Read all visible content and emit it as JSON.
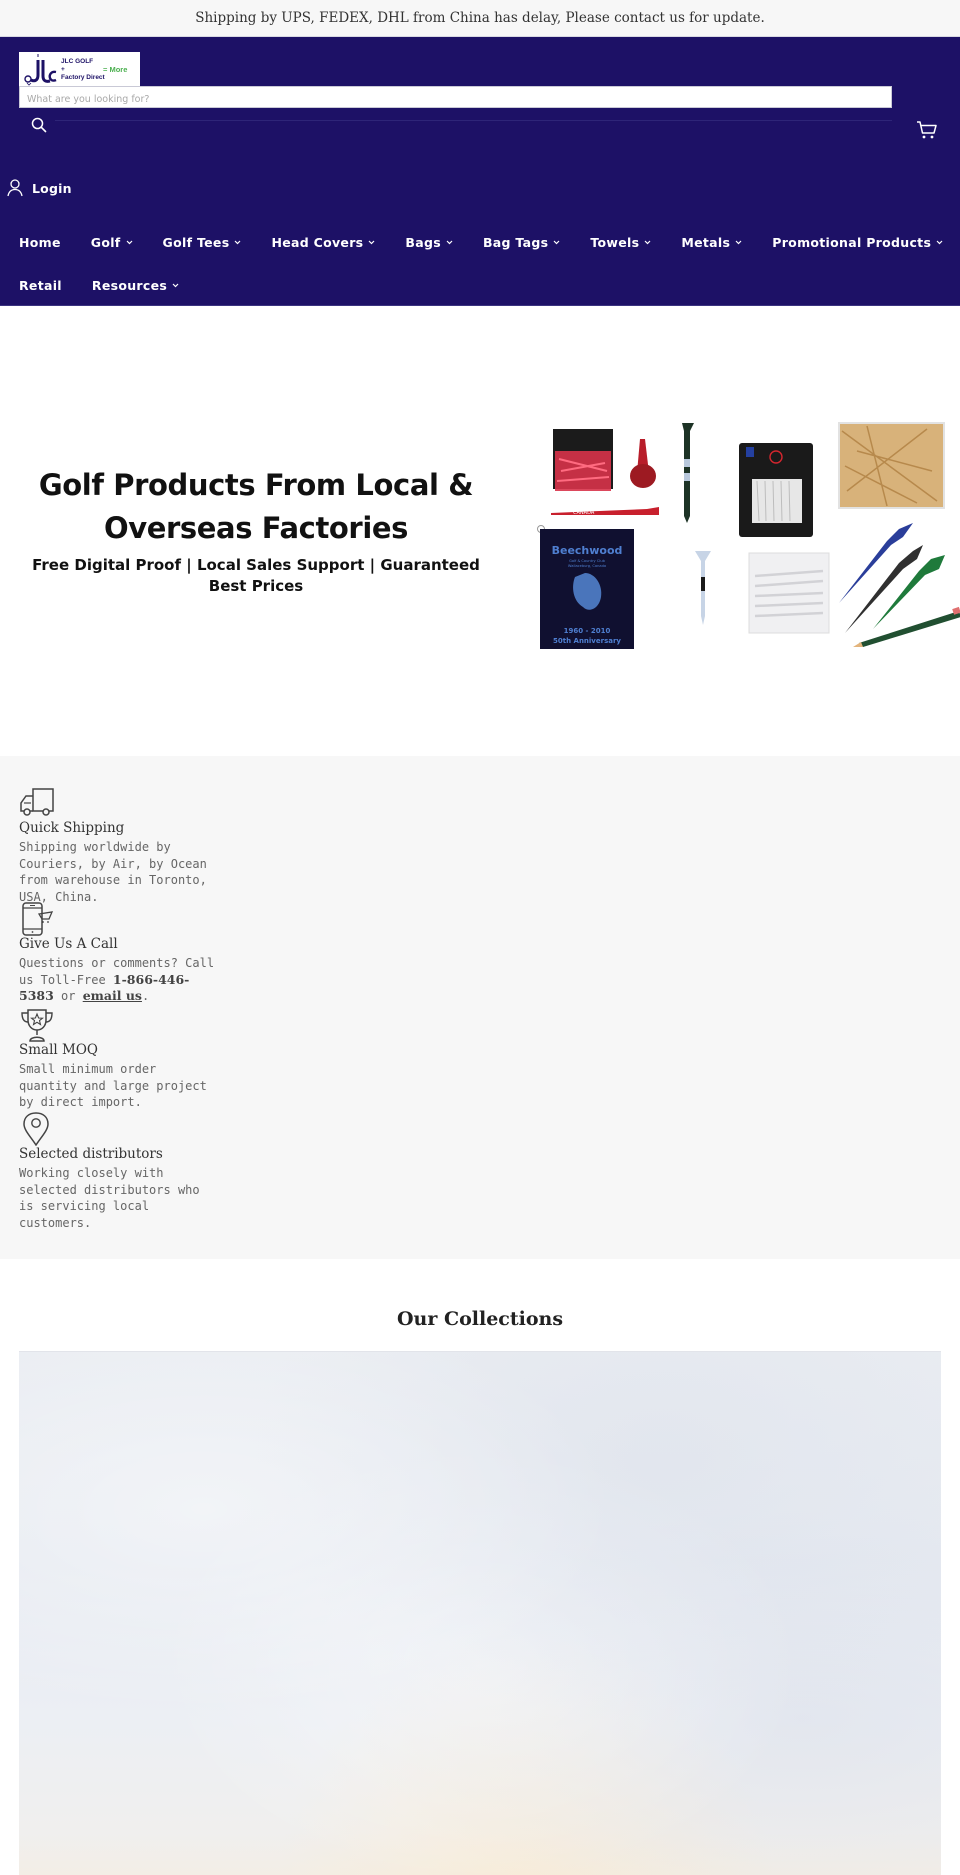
{
  "announcement": {
    "text": "Shipping by UPS, FEDEX, DHL from China has delay, Please contact us for update."
  },
  "header": {
    "logo": {
      "line1": "JLC GOLF",
      "line2": "+",
      "line3": "Factory Direct",
      "tagline": "= More",
      "tagline_color": "#4cb050"
    },
    "search": {
      "placeholder": "What are you looking for?",
      "value": "",
      "icon": "search-icon"
    },
    "cart_icon": "cart-icon",
    "login": {
      "label": "Login",
      "icon": "user-icon"
    },
    "background_color": "#1d1166"
  },
  "nav": {
    "row1": [
      {
        "label": "Home",
        "has_dropdown": false
      },
      {
        "label": "Golf",
        "has_dropdown": true
      },
      {
        "label": "Golf Tees",
        "has_dropdown": true
      },
      {
        "label": "Head Covers",
        "has_dropdown": true
      },
      {
        "label": "Bags",
        "has_dropdown": true
      },
      {
        "label": "Bag Tags",
        "has_dropdown": true
      },
      {
        "label": "Towels",
        "has_dropdown": true
      },
      {
        "label": "Metals",
        "has_dropdown": true
      },
      {
        "label": "Promotional Products",
        "has_dropdown": true
      }
    ],
    "row2": [
      {
        "label": "Retail",
        "has_dropdown": false
      },
      {
        "label": "Resources",
        "has_dropdown": true
      }
    ]
  },
  "hero": {
    "title": "Golf Products From Local & Overseas Factories",
    "subtitle": "Free Digital Proof | Local Sales Support | Guaranteed Best Prices",
    "image_alt": "Golf products collage: tees, towels, divot tools, pencils",
    "image_texts": {
      "towel_name": "Beechwood",
      "towel_sub1": "Golf & Country Club",
      "towel_sub2": "Wallaceburg, Canada",
      "towel_years": "1960 - 2010",
      "towel_anniv": "50th Anniversary",
      "tee_text": "CANADA"
    }
  },
  "features": [
    {
      "icon": "truck-icon",
      "title": "Quick Shipping",
      "text": "Shipping worldwide by Couriers, by Air, by Ocean from warehouse in Toronto, USA, China."
    },
    {
      "icon": "phone-icon",
      "title": "Give Us A Call",
      "text_before": "Questions or comments? Call us Toll-Free ",
      "phone": "1-866-446-5383",
      "text_mid": " or ",
      "link": "email us",
      "text_after": "."
    },
    {
      "icon": "trophy-icon",
      "title": "Small MOQ",
      "text": "Small minimum order quantity and large project by direct import."
    },
    {
      "icon": "map-pin-icon",
      "title": "Selected distributors",
      "text": "Working closely with selected distributors who is servicing local customers."
    }
  ],
  "collections": {
    "title": "Our Collections"
  }
}
